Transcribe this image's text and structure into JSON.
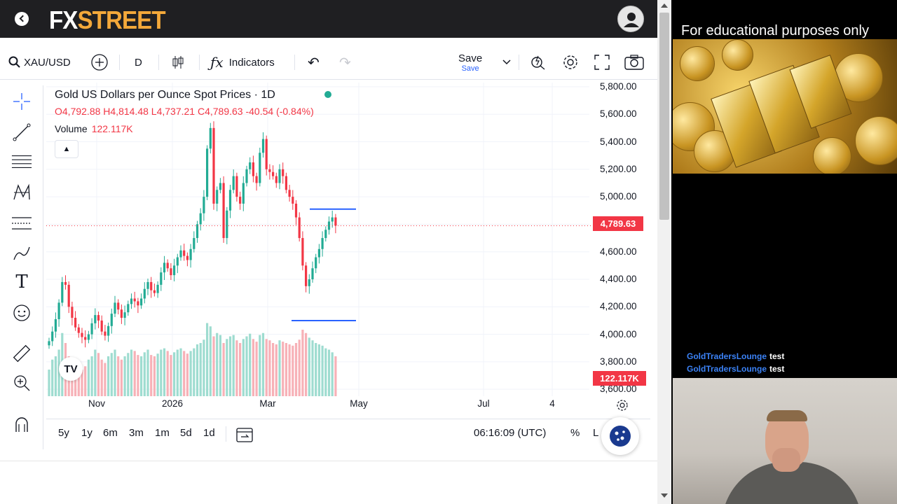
{
  "browser": {
    "logo_part1": "FX",
    "logo_part2": "STREET",
    "back_icon": "back-arrow-icon",
    "avatar_icon": "user-avatar-icon"
  },
  "toolbar": {
    "symbol": "XAU/USD",
    "interval": "D",
    "indicators_label": "Indicators",
    "save_label": "Save",
    "save_sub": "Save"
  },
  "legend": {
    "title": "Gold US Dollars per Ounce Spot Prices · 1D",
    "open": "O4,792.88",
    "high": "H4,814.48",
    "low": "L4,737.21",
    "close": "C4,789.63",
    "change": "-40.54 (-0.84%)",
    "volume_label": "Volume",
    "volume_value": "122.117K"
  },
  "price_tag": "4,789.63",
  "volume_tag": "122.117K",
  "bottom": {
    "ranges": [
      "5y",
      "1y",
      "6m",
      "3m",
      "1m",
      "5d",
      "1d"
    ],
    "utc_time": "06:16:09 (UTC)",
    "percent": "%",
    "log": "L"
  },
  "chart_data": {
    "type": "candlestick",
    "title": "Gold US Dollars per Ounce Spot Prices · 1D",
    "y_ticks": [
      "5,800.00",
      "5,600.00",
      "5,400.00",
      "5,200.00",
      "5,000.00",
      "4,800.00",
      "4,600.00",
      "4,400.00",
      "4,200.00",
      "4,000.00",
      "3,800.00",
      "3,600.00"
    ],
    "x_ticks": [
      "Nov",
      "2026",
      "Mar",
      "May",
      "Jul",
      "4"
    ],
    "ylim": [
      3550,
      5820
    ],
    "last_price": 4789.63,
    "horizontal_levels": [
      4910,
      4100
    ],
    "closes": [
      3950,
      4020,
      4110,
      4230,
      4380,
      4360,
      4200,
      4120,
      4050,
      4010,
      3980,
      3960,
      4000,
      4080,
      4140,
      4100,
      4020,
      3990,
      4060,
      4150,
      4230,
      4180,
      4120,
      4160,
      4220,
      4260,
      4240,
      4210,
      4260,
      4330,
      4380,
      4320,
      4300,
      4360,
      4450,
      4520,
      4480,
      4430,
      4500,
      4560,
      4610,
      4570,
      4540,
      4620,
      4700,
      4800,
      4880,
      5000,
      5350,
      5500,
      4950,
      5050,
      5100,
      4700,
      4900,
      5050,
      5150,
      5000,
      4950,
      5100,
      5200,
      5250,
      5150,
      5100,
      5320,
      5420,
      5200,
      5180,
      5150,
      5100,
      5200,
      5150,
      5050,
      5000,
      4950,
      4850,
      4700,
      4500,
      4350,
      4400,
      4480,
      4560,
      4620,
      4700,
      4760,
      4820,
      4850,
      4790
    ],
    "volumes": [
      40,
      55,
      60,
      70,
      95,
      80,
      60,
      55,
      50,
      45,
      40,
      45,
      55,
      60,
      70,
      65,
      55,
      50,
      60,
      65,
      70,
      60,
      55,
      60,
      65,
      70,
      68,
      62,
      60,
      66,
      70,
      62,
      60,
      64,
      70,
      72,
      68,
      62,
      66,
      70,
      72,
      68,
      64,
      68,
      72,
      78,
      80,
      85,
      110,
      105,
      90,
      95,
      92,
      80,
      86,
      90,
      92,
      84,
      80,
      86,
      90,
      94,
      86,
      82,
      92,
      95,
      86,
      84,
      80,
      78,
      84,
      82,
      80,
      78,
      76,
      80,
      85,
      100,
      95,
      88,
      84,
      80,
      78,
      76,
      72,
      70,
      66,
      60
    ]
  },
  "stream": {
    "overlay_title": "For educational purposes only",
    "chat": [
      {
        "user": "GoldTradersLounge",
        "msg": "test"
      },
      {
        "user": "GoldTradersLounge",
        "msg": "test"
      }
    ]
  },
  "colors": {
    "up": "#22ab94",
    "down": "#f23645",
    "up_vol": "#9edcd0",
    "down_vol": "#f7b1b7",
    "level_line": "#2962ff"
  }
}
